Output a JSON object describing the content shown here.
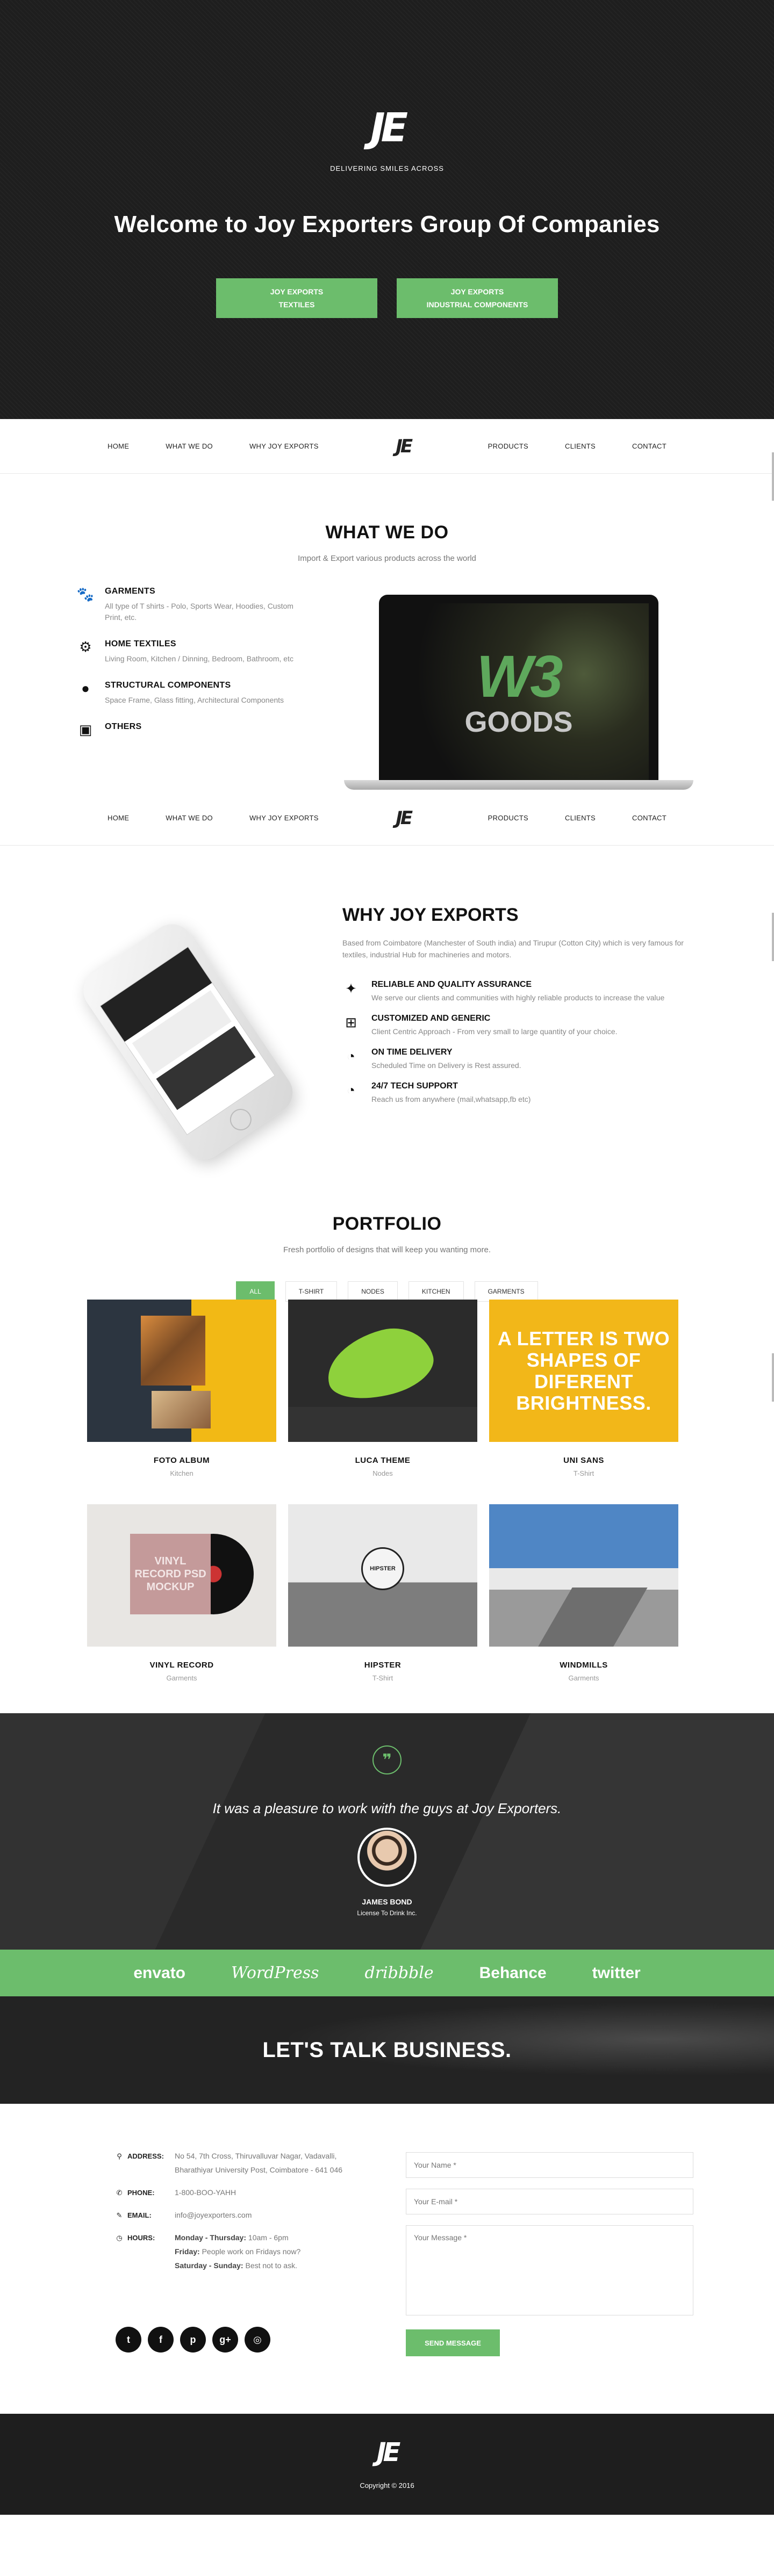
{
  "hero": {
    "logo": "JE",
    "tagline": "DELIVERING SMILES ACROSS",
    "title": "Welcome to Joy Exporters Group Of Companies",
    "buttons": [
      {
        "line1": "JOY EXPORTS",
        "line2": "TEXTILES"
      },
      {
        "line1": "JOY EXPORTS",
        "line2": "INDUSTRIAL COMPONENTS"
      }
    ]
  },
  "nav": {
    "left": [
      "HOME",
      "WHAT WE DO",
      "WHY JOY EXPORTS"
    ],
    "logo": "JE",
    "right": [
      "PRODUCTS",
      "CLIENTS",
      "CONTACT"
    ]
  },
  "what_we_do": {
    "title": "WHAT WE DO",
    "subtitle": "Import & Export various products across the world",
    "items": [
      {
        "icon": "paw-icon",
        "name": "GARMENTS",
        "desc": "All type of T shirts - Polo, Sports Wear, Hoodies, Custom Print, etc."
      },
      {
        "icon": "gear-icon",
        "name": "HOME TEXTILES",
        "desc": "Living Room, Kitchen / Dinning, Bedroom, Bathroom, etc"
      },
      {
        "icon": "apple-icon",
        "name": "STRUCTURAL COMPONENTS",
        "desc": "Space Frame, Glass fitting, Architectural Components"
      },
      {
        "icon": "briefcase-icon",
        "name": "OTHERS",
        "desc": ""
      }
    ],
    "laptop_screen": {
      "line1": "W3",
      "line2": "GOODS"
    }
  },
  "why": {
    "title": "WHY JOY EXPORTS",
    "intro": "Based from Coimbatore (Manchester of South india) and Tirupur (Cotton City) which is very famous for textiles, industrial Hub for machineries and motors.",
    "items": [
      {
        "icon": "magic-wand-icon",
        "name": "RELIABLE AND QUALITY ASSURANCE",
        "desc": "We serve our clients and communities with highly reliable products to increase the value"
      },
      {
        "icon": "gift-icon",
        "name": "CUSTOMIZED AND GENERIC",
        "desc": "Client Centric Approach - From very small to large quantity of your choice."
      },
      {
        "icon": "dashboard-icon",
        "name": "ON TIME DELIVERY",
        "desc": "Scheduled Time on Delivery is Rest assured."
      },
      {
        "icon": "dashboard-icon",
        "name": "24/7 TECH SUPPORT",
        "desc": "Reach us from anywhere (mail,whatsapp,fb etc)"
      }
    ]
  },
  "portfolio": {
    "title": "PORTFOLIO",
    "subtitle": "Fresh portfolio of designs that will keep you wanting more.",
    "filters": [
      "ALL",
      "T-SHIRT",
      "NODES",
      "KITCHEN",
      "GARMENTS"
    ],
    "active_filter": "ALL",
    "items": [
      {
        "title": "FOTO ALBUM",
        "category": "Kitchen"
      },
      {
        "title": "LUCA THEME",
        "category": "Nodes"
      },
      {
        "title": "UNI SANS",
        "category": "T-Shirt",
        "image_text": "A LETTER IS TWO SHAPES OF DIFERENT BRIGHTNESS."
      },
      {
        "title": "VINYL RECORD",
        "category": "Garments",
        "image_text": "VINYL RECORD PSD MOCKUP"
      },
      {
        "title": "HIPSTER",
        "category": "T-Shirt",
        "image_text": "HIPSTER"
      },
      {
        "title": "WINDMILLS",
        "category": "Garments"
      }
    ]
  },
  "testimonial": {
    "quote": "It was a pleasure to work with the guys at Joy Exporters.",
    "name": "JAMES BOND",
    "role": "License To Drink Inc."
  },
  "clients": [
    "envato",
    "WordPress",
    "dribbble",
    "Behance",
    "twitter"
  ],
  "cta": {
    "text": "LET'S TALK BUSINESS."
  },
  "contact": {
    "address_label": "ADDRESS:",
    "address": "No 54, 7th Cross, Thiruvalluvar Nagar, Vadavalli, Bharathiyar University Post, Coimbatore - 641 046",
    "phone_label": "PHONE:",
    "phone": "1-800-BOO-YAHH",
    "email_label": "EMAIL:",
    "email": "info@joyexporters.com",
    "hours_label": "HOURS:",
    "hours": [
      {
        "day": "Monday - Thursday:",
        "time": " 10am - 6pm"
      },
      {
        "day": "Friday:",
        "time": " People work on Fridays now?"
      },
      {
        "day": "Saturday - Sunday:",
        "time": " Best not to ask."
      }
    ],
    "socials": [
      "twitter-icon",
      "facebook-icon",
      "pinterest-icon",
      "google-plus-icon",
      "dribbble-icon"
    ],
    "form": {
      "name_placeholder": "Your Name *",
      "email_placeholder": "Your E-mail *",
      "message_placeholder": "Your Message *",
      "submit": "SEND MESSAGE"
    }
  },
  "footer": {
    "logo": "JE",
    "copyright": "Copyright © 2016"
  },
  "colors": {
    "accent": "#6cbd6c",
    "dark": "#1e1e1e"
  }
}
